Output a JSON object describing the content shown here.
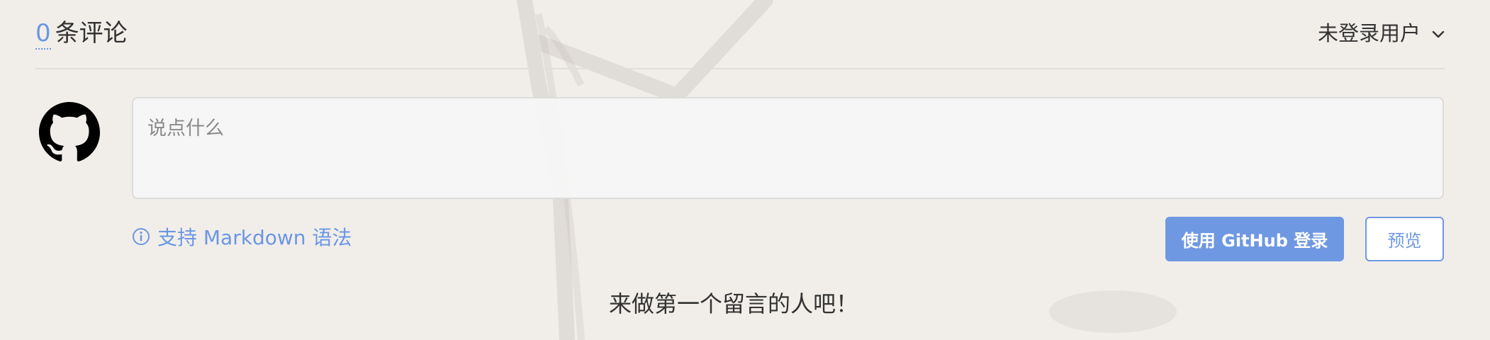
{
  "header": {
    "comment_count": "0",
    "comment_label": "条评论",
    "user_menu_label": "未登录用户"
  },
  "editor": {
    "placeholder": "说点什么"
  },
  "hint": {
    "markdown_label": "支持 Markdown 语法"
  },
  "actions": {
    "login_button": "使用 GitHub 登录",
    "preview_button": "预览"
  },
  "empty_state": {
    "message": "来做第一个留言的人吧！"
  },
  "icons": {
    "avatar": "github-octocat-icon",
    "user_menu": "chevron-down-icon",
    "hint": "info-circle-icon"
  },
  "colors": {
    "accent": "#6f98e2",
    "background": "#f1eeea",
    "text": "#333333"
  }
}
